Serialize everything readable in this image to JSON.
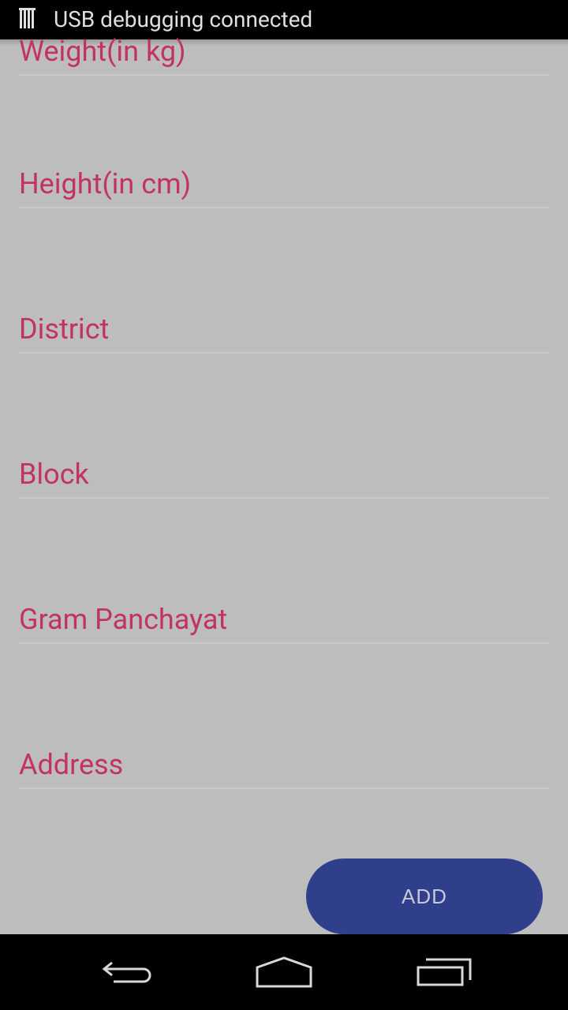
{
  "status_bar": {
    "icon": "usb-debug-icon",
    "text": "USB debugging connected"
  },
  "form": {
    "fields": [
      {
        "label": "Weight(in kg)"
      },
      {
        "label": "Height(in cm)"
      },
      {
        "label": "District"
      },
      {
        "label": "Block"
      },
      {
        "label": "Gram Panchayat"
      },
      {
        "label": "Address"
      }
    ]
  },
  "add_button": {
    "label": "ADD"
  },
  "nav_bar": {
    "back_icon": "back-icon",
    "home_icon": "home-icon",
    "recents_icon": "recent-apps-icon"
  },
  "colors": {
    "label": "#c2345f",
    "button": "#303f8c",
    "background": "#bdbdbd"
  }
}
